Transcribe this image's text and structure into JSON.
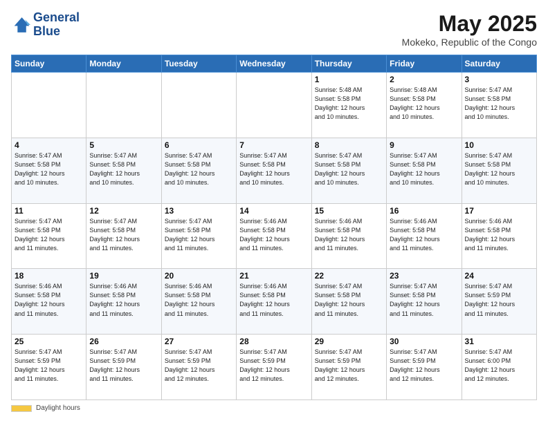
{
  "header": {
    "logo_line1": "General",
    "logo_line2": "Blue",
    "main_title": "May 2025",
    "subtitle": "Mokeko, Republic of the Congo"
  },
  "calendar": {
    "days_of_week": [
      "Sunday",
      "Monday",
      "Tuesday",
      "Wednesday",
      "Thursday",
      "Friday",
      "Saturday"
    ],
    "weeks": [
      [
        {
          "day": "",
          "info": ""
        },
        {
          "day": "",
          "info": ""
        },
        {
          "day": "",
          "info": ""
        },
        {
          "day": "",
          "info": ""
        },
        {
          "day": "1",
          "info": "Sunrise: 5:48 AM\nSunset: 5:58 PM\nDaylight: 12 hours\nand 10 minutes."
        },
        {
          "day": "2",
          "info": "Sunrise: 5:48 AM\nSunset: 5:58 PM\nDaylight: 12 hours\nand 10 minutes."
        },
        {
          "day": "3",
          "info": "Sunrise: 5:47 AM\nSunset: 5:58 PM\nDaylight: 12 hours\nand 10 minutes."
        }
      ],
      [
        {
          "day": "4",
          "info": "Sunrise: 5:47 AM\nSunset: 5:58 PM\nDaylight: 12 hours\nand 10 minutes."
        },
        {
          "day": "5",
          "info": "Sunrise: 5:47 AM\nSunset: 5:58 PM\nDaylight: 12 hours\nand 10 minutes."
        },
        {
          "day": "6",
          "info": "Sunrise: 5:47 AM\nSunset: 5:58 PM\nDaylight: 12 hours\nand 10 minutes."
        },
        {
          "day": "7",
          "info": "Sunrise: 5:47 AM\nSunset: 5:58 PM\nDaylight: 12 hours\nand 10 minutes."
        },
        {
          "day": "8",
          "info": "Sunrise: 5:47 AM\nSunset: 5:58 PM\nDaylight: 12 hours\nand 10 minutes."
        },
        {
          "day": "9",
          "info": "Sunrise: 5:47 AM\nSunset: 5:58 PM\nDaylight: 12 hours\nand 10 minutes."
        },
        {
          "day": "10",
          "info": "Sunrise: 5:47 AM\nSunset: 5:58 PM\nDaylight: 12 hours\nand 10 minutes."
        }
      ],
      [
        {
          "day": "11",
          "info": "Sunrise: 5:47 AM\nSunset: 5:58 PM\nDaylight: 12 hours\nand 11 minutes."
        },
        {
          "day": "12",
          "info": "Sunrise: 5:47 AM\nSunset: 5:58 PM\nDaylight: 12 hours\nand 11 minutes."
        },
        {
          "day": "13",
          "info": "Sunrise: 5:47 AM\nSunset: 5:58 PM\nDaylight: 12 hours\nand 11 minutes."
        },
        {
          "day": "14",
          "info": "Sunrise: 5:46 AM\nSunset: 5:58 PM\nDaylight: 12 hours\nand 11 minutes."
        },
        {
          "day": "15",
          "info": "Sunrise: 5:46 AM\nSunset: 5:58 PM\nDaylight: 12 hours\nand 11 minutes."
        },
        {
          "day": "16",
          "info": "Sunrise: 5:46 AM\nSunset: 5:58 PM\nDaylight: 12 hours\nand 11 minutes."
        },
        {
          "day": "17",
          "info": "Sunrise: 5:46 AM\nSunset: 5:58 PM\nDaylight: 12 hours\nand 11 minutes."
        }
      ],
      [
        {
          "day": "18",
          "info": "Sunrise: 5:46 AM\nSunset: 5:58 PM\nDaylight: 12 hours\nand 11 minutes."
        },
        {
          "day": "19",
          "info": "Sunrise: 5:46 AM\nSunset: 5:58 PM\nDaylight: 12 hours\nand 11 minutes."
        },
        {
          "day": "20",
          "info": "Sunrise: 5:46 AM\nSunset: 5:58 PM\nDaylight: 12 hours\nand 11 minutes."
        },
        {
          "day": "21",
          "info": "Sunrise: 5:46 AM\nSunset: 5:58 PM\nDaylight: 12 hours\nand 11 minutes."
        },
        {
          "day": "22",
          "info": "Sunrise: 5:47 AM\nSunset: 5:58 PM\nDaylight: 12 hours\nand 11 minutes."
        },
        {
          "day": "23",
          "info": "Sunrise: 5:47 AM\nSunset: 5:58 PM\nDaylight: 12 hours\nand 11 minutes."
        },
        {
          "day": "24",
          "info": "Sunrise: 5:47 AM\nSunset: 5:59 PM\nDaylight: 12 hours\nand 11 minutes."
        }
      ],
      [
        {
          "day": "25",
          "info": "Sunrise: 5:47 AM\nSunset: 5:59 PM\nDaylight: 12 hours\nand 11 minutes."
        },
        {
          "day": "26",
          "info": "Sunrise: 5:47 AM\nSunset: 5:59 PM\nDaylight: 12 hours\nand 11 minutes."
        },
        {
          "day": "27",
          "info": "Sunrise: 5:47 AM\nSunset: 5:59 PM\nDaylight: 12 hours\nand 12 minutes."
        },
        {
          "day": "28",
          "info": "Sunrise: 5:47 AM\nSunset: 5:59 PM\nDaylight: 12 hours\nand 12 minutes."
        },
        {
          "day": "29",
          "info": "Sunrise: 5:47 AM\nSunset: 5:59 PM\nDaylight: 12 hours\nand 12 minutes."
        },
        {
          "day": "30",
          "info": "Sunrise: 5:47 AM\nSunset: 5:59 PM\nDaylight: 12 hours\nand 12 minutes."
        },
        {
          "day": "31",
          "info": "Sunrise: 5:47 AM\nSunset: 6:00 PM\nDaylight: 12 hours\nand 12 minutes."
        }
      ]
    ]
  },
  "footer": {
    "daylight_label": "Daylight hours"
  }
}
